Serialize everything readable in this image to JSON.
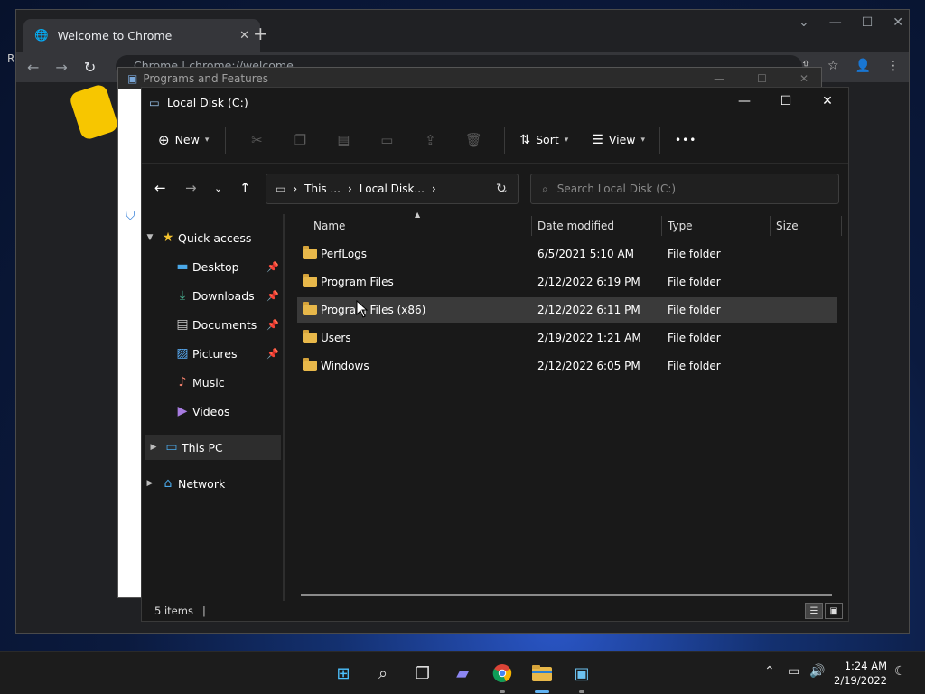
{
  "chrome": {
    "tab_title": "Welcome to Chrome",
    "omnibox": "Chrome | chrome://welcome",
    "side_letter": "R"
  },
  "paf": {
    "title": "Programs and Features"
  },
  "explorer": {
    "title": "Local Disk (C:)",
    "toolbar": {
      "new_label": "New",
      "sort_label": "Sort",
      "view_label": "View",
      "more_label": "•••"
    },
    "address": {
      "crumbs": [
        "This ...",
        "Local Disk..."
      ]
    },
    "search_placeholder": "Search Local Disk (C:)",
    "nav": {
      "quick_access": "Quick access",
      "items": [
        {
          "label": "Desktop",
          "pinned": true
        },
        {
          "label": "Downloads",
          "pinned": true
        },
        {
          "label": "Documents",
          "pinned": true
        },
        {
          "label": "Pictures",
          "pinned": true
        },
        {
          "label": "Music",
          "pinned": false
        },
        {
          "label": "Videos",
          "pinned": false
        }
      ],
      "this_pc": "This PC",
      "network": "Network"
    },
    "columns": [
      "Name",
      "Date modified",
      "Type",
      "Size"
    ],
    "files": [
      {
        "name": "PerfLogs",
        "date": "6/5/2021 5:10 AM",
        "type": "File folder"
      },
      {
        "name": "Program Files",
        "date": "2/12/2022 6:19 PM",
        "type": "File folder"
      },
      {
        "name": "Program Files (x86)",
        "date": "2/12/2022 6:11 PM",
        "type": "File folder",
        "selected": true
      },
      {
        "name": "Users",
        "date": "2/19/2022 1:21 AM",
        "type": "File folder"
      },
      {
        "name": "Windows",
        "date": "2/12/2022 6:05 PM",
        "type": "File folder"
      }
    ],
    "status": "5 items"
  },
  "taskbar": {
    "time": "1:24 AM",
    "date": "2/19/2022"
  },
  "colors": {
    "accent": "#5fb2f2",
    "folder": "#e8b84a",
    "explorer_bg": "#191919"
  }
}
